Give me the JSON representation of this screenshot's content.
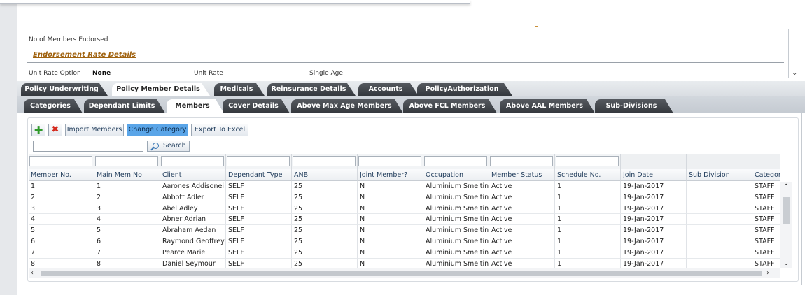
{
  "summary": {
    "members_endorsed_label": "No of Members Endorsed",
    "rate_section_title": "Endorsement Rate Details",
    "unit_rate_option_label": "Unit Rate Option",
    "unit_rate_option_value": "None",
    "unit_rate_label": "Unit Rate",
    "single_age_label": "Single Age"
  },
  "main_tabs": [
    {
      "label": "Policy Underwriting",
      "active": false
    },
    {
      "label": "Policy Member Details",
      "active": true
    },
    {
      "label": "Medicals",
      "active": false
    },
    {
      "label": "Reinsurance Details",
      "active": false
    },
    {
      "label": "Accounts",
      "active": false
    },
    {
      "label": "PolicyAuthorization",
      "active": false
    }
  ],
  "sub_tabs": [
    {
      "label": "Categories",
      "active": false
    },
    {
      "label": "Dependant Limits",
      "active": false
    },
    {
      "label": "Members",
      "active": true
    },
    {
      "label": "Cover Details",
      "active": false
    },
    {
      "label": "Above Max Age Members",
      "active": false
    },
    {
      "label": "Above FCL Members",
      "active": false
    },
    {
      "label": "Above AAL Members",
      "active": false
    },
    {
      "label": "Sub-Divisions",
      "active": false
    }
  ],
  "toolbar": {
    "add_icon": "plus-icon",
    "delete_icon": "x-icon",
    "import_label": "Import Members",
    "change_category_label": "Change Category",
    "export_label": "Export To Excel"
  },
  "search": {
    "value": "",
    "button_label": "Search",
    "icon": "magnifier-icon"
  },
  "table": {
    "columns": [
      "Member No.",
      "Main Mem No",
      "Client",
      "Dependant Type",
      "ANB",
      "Joint Member?",
      "Occupation",
      "Member Status",
      "Schedule No.",
      "Join Date",
      "Sub Division",
      "Categor"
    ],
    "rows": [
      [
        "1",
        "1",
        "Aarones Addisonei",
        "SELF",
        "25",
        "N",
        "Aluminium Smelting",
        "Active",
        "1",
        "19-Jan-2017",
        "",
        "STAFF"
      ],
      [
        "2",
        "2",
        "Abbott Adler",
        "SELF",
        "25",
        "N",
        "Aluminium Smelting",
        "Active",
        "1",
        "19-Jan-2017",
        "",
        "STAFF"
      ],
      [
        "3",
        "3",
        "Abel Adley",
        "SELF",
        "25",
        "N",
        "Aluminium Smelting",
        "Active",
        "1",
        "19-Jan-2017",
        "",
        "STAFF"
      ],
      [
        "4",
        "4",
        "Abner Adrian",
        "SELF",
        "25",
        "N",
        "Aluminium Smelting",
        "Active",
        "1",
        "19-Jan-2017",
        "",
        "STAFF"
      ],
      [
        "5",
        "5",
        "Abraham Aedan",
        "SELF",
        "25",
        "N",
        "Aluminium Smelting",
        "Active",
        "1",
        "19-Jan-2017",
        "",
        "STAFF"
      ],
      [
        "6",
        "6",
        "Raymond Geoffrey",
        "SELF",
        "25",
        "N",
        "Aluminium Smelting",
        "Active",
        "1",
        "19-Jan-2017",
        "",
        "STAFF"
      ],
      [
        "7",
        "7",
        "Pearce Marie",
        "SELF",
        "25",
        "N",
        "Aluminium Smelting",
        "Active",
        "1",
        "19-Jan-2017",
        "",
        "STAFF"
      ],
      [
        "8",
        "8",
        "Daniel Seymour",
        "SELF",
        "25",
        "N",
        "Aluminium Smelting",
        "Active",
        "1",
        "19-Jan-2017",
        "",
        "STAFF"
      ]
    ]
  },
  "colors": {
    "tab_dark": "#3f4348",
    "section_title": "#a0620f",
    "selected_button": "#5aa5e8"
  }
}
